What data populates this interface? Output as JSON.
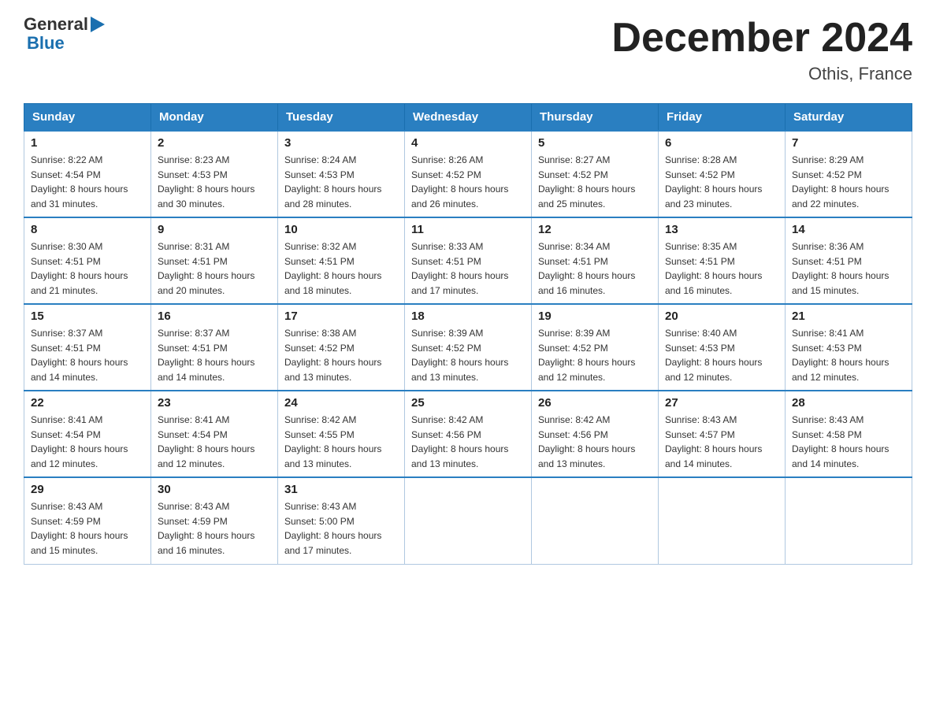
{
  "logo": {
    "general": "General",
    "blue": "Blue"
  },
  "title": "December 2024",
  "location": "Othis, France",
  "weekdays": [
    "Sunday",
    "Monday",
    "Tuesday",
    "Wednesday",
    "Thursday",
    "Friday",
    "Saturday"
  ],
  "weeks": [
    [
      {
        "day": "1",
        "sunrise": "8:22 AM",
        "sunset": "4:54 PM",
        "daylight": "8 hours and 31 minutes."
      },
      {
        "day": "2",
        "sunrise": "8:23 AM",
        "sunset": "4:53 PM",
        "daylight": "8 hours and 30 minutes."
      },
      {
        "day": "3",
        "sunrise": "8:24 AM",
        "sunset": "4:53 PM",
        "daylight": "8 hours and 28 minutes."
      },
      {
        "day": "4",
        "sunrise": "8:26 AM",
        "sunset": "4:52 PM",
        "daylight": "8 hours and 26 minutes."
      },
      {
        "day": "5",
        "sunrise": "8:27 AM",
        "sunset": "4:52 PM",
        "daylight": "8 hours and 25 minutes."
      },
      {
        "day": "6",
        "sunrise": "8:28 AM",
        "sunset": "4:52 PM",
        "daylight": "8 hours and 23 minutes."
      },
      {
        "day": "7",
        "sunrise": "8:29 AM",
        "sunset": "4:52 PM",
        "daylight": "8 hours and 22 minutes."
      }
    ],
    [
      {
        "day": "8",
        "sunrise": "8:30 AM",
        "sunset": "4:51 PM",
        "daylight": "8 hours and 21 minutes."
      },
      {
        "day": "9",
        "sunrise": "8:31 AM",
        "sunset": "4:51 PM",
        "daylight": "8 hours and 20 minutes."
      },
      {
        "day": "10",
        "sunrise": "8:32 AM",
        "sunset": "4:51 PM",
        "daylight": "8 hours and 18 minutes."
      },
      {
        "day": "11",
        "sunrise": "8:33 AM",
        "sunset": "4:51 PM",
        "daylight": "8 hours and 17 minutes."
      },
      {
        "day": "12",
        "sunrise": "8:34 AM",
        "sunset": "4:51 PM",
        "daylight": "8 hours and 16 minutes."
      },
      {
        "day": "13",
        "sunrise": "8:35 AM",
        "sunset": "4:51 PM",
        "daylight": "8 hours and 16 minutes."
      },
      {
        "day": "14",
        "sunrise": "8:36 AM",
        "sunset": "4:51 PM",
        "daylight": "8 hours and 15 minutes."
      }
    ],
    [
      {
        "day": "15",
        "sunrise": "8:37 AM",
        "sunset": "4:51 PM",
        "daylight": "8 hours and 14 minutes."
      },
      {
        "day": "16",
        "sunrise": "8:37 AM",
        "sunset": "4:51 PM",
        "daylight": "8 hours and 14 minutes."
      },
      {
        "day": "17",
        "sunrise": "8:38 AM",
        "sunset": "4:52 PM",
        "daylight": "8 hours and 13 minutes."
      },
      {
        "day": "18",
        "sunrise": "8:39 AM",
        "sunset": "4:52 PM",
        "daylight": "8 hours and 13 minutes."
      },
      {
        "day": "19",
        "sunrise": "8:39 AM",
        "sunset": "4:52 PM",
        "daylight": "8 hours and 12 minutes."
      },
      {
        "day": "20",
        "sunrise": "8:40 AM",
        "sunset": "4:53 PM",
        "daylight": "8 hours and 12 minutes."
      },
      {
        "day": "21",
        "sunrise": "8:41 AM",
        "sunset": "4:53 PM",
        "daylight": "8 hours and 12 minutes."
      }
    ],
    [
      {
        "day": "22",
        "sunrise": "8:41 AM",
        "sunset": "4:54 PM",
        "daylight": "8 hours and 12 minutes."
      },
      {
        "day": "23",
        "sunrise": "8:41 AM",
        "sunset": "4:54 PM",
        "daylight": "8 hours and 12 minutes."
      },
      {
        "day": "24",
        "sunrise": "8:42 AM",
        "sunset": "4:55 PM",
        "daylight": "8 hours and 13 minutes."
      },
      {
        "day": "25",
        "sunrise": "8:42 AM",
        "sunset": "4:56 PM",
        "daylight": "8 hours and 13 minutes."
      },
      {
        "day": "26",
        "sunrise": "8:42 AM",
        "sunset": "4:56 PM",
        "daylight": "8 hours and 13 minutes."
      },
      {
        "day": "27",
        "sunrise": "8:43 AM",
        "sunset": "4:57 PM",
        "daylight": "8 hours and 14 minutes."
      },
      {
        "day": "28",
        "sunrise": "8:43 AM",
        "sunset": "4:58 PM",
        "daylight": "8 hours and 14 minutes."
      }
    ],
    [
      {
        "day": "29",
        "sunrise": "8:43 AM",
        "sunset": "4:59 PM",
        "daylight": "8 hours and 15 minutes."
      },
      {
        "day": "30",
        "sunrise": "8:43 AM",
        "sunset": "4:59 PM",
        "daylight": "8 hours and 16 minutes."
      },
      {
        "day": "31",
        "sunrise": "8:43 AM",
        "sunset": "5:00 PM",
        "daylight": "8 hours and 17 minutes."
      },
      null,
      null,
      null,
      null
    ]
  ]
}
